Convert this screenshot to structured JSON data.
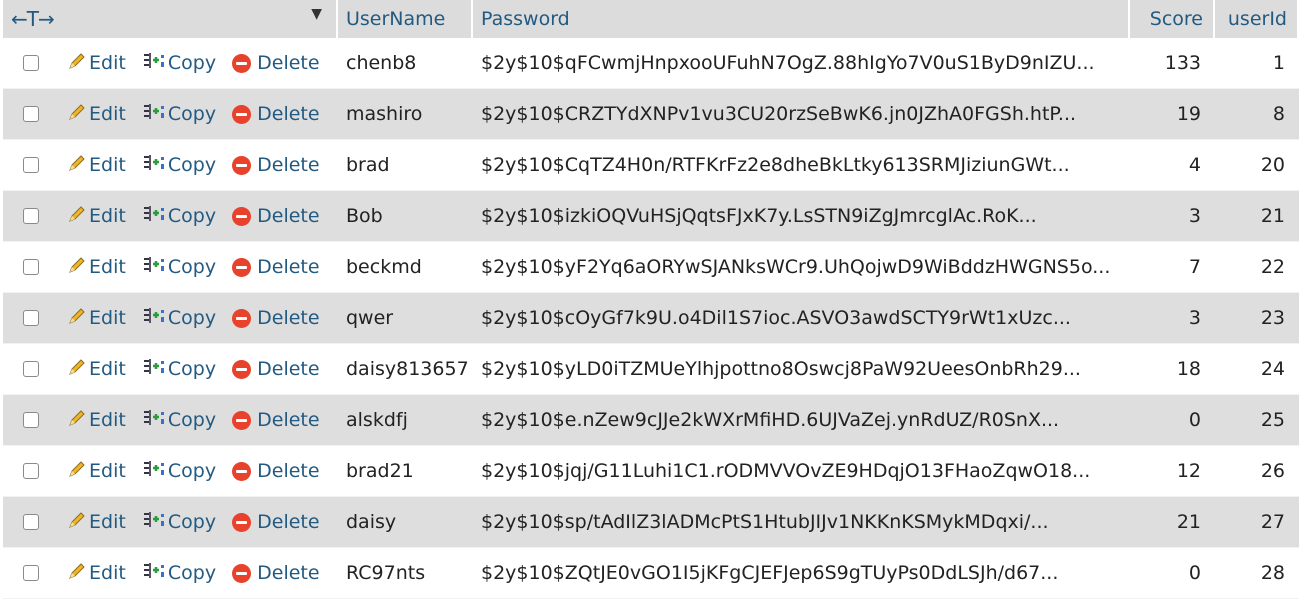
{
  "header": {
    "nav_arrows": "←T→",
    "sort_indicator": "▼",
    "columns": [
      "UserName",
      "Password",
      "Score",
      "userId"
    ]
  },
  "actions": {
    "edit": "Edit",
    "copy": "Copy",
    "delete": "Delete"
  },
  "rows": [
    {
      "username": "chenb8",
      "password": "$2y$10$qFCwmjHnpxooUFuhN7OgZ.88hIgYo7V0uS1ByD9nIZU...",
      "score": "133",
      "userid": "1"
    },
    {
      "username": "mashiro",
      "password": "$2y$10$CRZTYdXNPv1vu3CU20rzSeBwK6.jn0JZhA0FGSh.htP...",
      "score": "19",
      "userid": "8"
    },
    {
      "username": "brad",
      "password": "$2y$10$CqTZ4H0n/RTFKrFz2e8dheBkLtky613SRMJiziunGWt...",
      "score": "4",
      "userid": "20"
    },
    {
      "username": "Bob",
      "password": "$2y$10$izkiOQVuHSjQqtsFJxK7y.LsSTN9iZgJmrcglAc.RoK...",
      "score": "3",
      "userid": "21"
    },
    {
      "username": "beckmd",
      "password": "$2y$10$yF2Yq6aORYwSJANksWCr9.UhQojwD9WiBddzHWGNS5o...",
      "score": "7",
      "userid": "22"
    },
    {
      "username": "qwer",
      "password": "$2y$10$cOyGf7k9U.o4Dil1S7ioc.ASVO3awdSCTY9rWt1xUzc...",
      "score": "3",
      "userid": "23"
    },
    {
      "username": "daisy813657",
      "password": "$2y$10$yLD0iTZMUeYlhjpottno8Oswcj8PaW92UeesOnbRh29...",
      "score": "18",
      "userid": "24"
    },
    {
      "username": "alskdfj",
      "password": "$2y$10$e.nZew9cJJe2kWXrMfiHD.6UJVaZej.ynRdUZ/R0SnX...",
      "score": "0",
      "userid": "25"
    },
    {
      "username": "brad21",
      "password": "$2y$10$jqj/G11Luhi1C1.rODMVVOvZE9HDqjO13FHaoZqwO18...",
      "score": "12",
      "userid": "26"
    },
    {
      "username": "daisy",
      "password": "$2y$10$sp/tAdIlZ3lADMcPtS1HtubJIJv1NKKnKSMykMDqxi/...",
      "score": "21",
      "userid": "27"
    },
    {
      "username": "RC97nts",
      "password": "$2y$10$ZQtJE0vGO1I5jKFgCJEFJep6S9gTUyPs0DdLSJh/d67...",
      "score": "0",
      "userid": "28"
    }
  ]
}
